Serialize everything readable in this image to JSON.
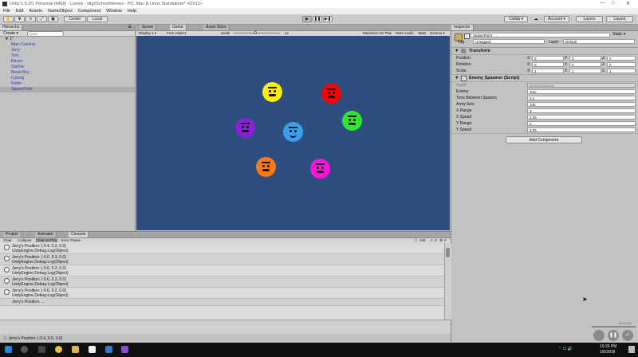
{
  "titlebar": {
    "title": "Unity 5.6.1f1 Personal (64bit) - Lonely - HighSchoolHeroes - PC, Mac & Linux Standalone* <DX11>"
  },
  "menu": [
    "File",
    "Edit",
    "Assets",
    "GameObject",
    "Component",
    "Window",
    "Help"
  ],
  "toolbar": {
    "center": "Center",
    "local": "Local",
    "collab": "Collab ▾",
    "account": "Account ▾",
    "layers": "Layers",
    "layout": "Layout"
  },
  "hierarchy": {
    "tab": "Hierarchy",
    "create": "Create ▾",
    "search_placeholder": "Q▾All",
    "scene": "1*",
    "items": [
      "Main Camera",
      "Jerry",
      "Tom",
      "Raven",
      "Starfire",
      "Beast Boy",
      "Cyborg",
      "Robin",
      "SpawnPoint"
    ]
  },
  "game": {
    "tabs": [
      "Scene",
      "Game",
      "Asset Store"
    ],
    "display": "Display 1 ▾",
    "aspect": "Free Aspect",
    "scale_label": "Scale",
    "scale_value": "1x",
    "options": [
      "Maximize On Play",
      "Mute Audio",
      "Stats",
      "Gizmos ▾"
    ],
    "faces": [
      {
        "name": "face-yellow",
        "color": "#ffee00"
      },
      {
        "name": "face-red",
        "color": "#ff0000"
      },
      {
        "name": "face-purple",
        "color": "#8a1fd8"
      },
      {
        "name": "face-blue",
        "color": "#3aa0ee"
      },
      {
        "name": "face-green",
        "color": "#2ee82e"
      },
      {
        "name": "face-orange",
        "color": "#ff7a10"
      },
      {
        "name": "face-magenta",
        "color": "#ff14d8"
      }
    ]
  },
  "console": {
    "tabs": [
      "Project",
      "Animator",
      "Console"
    ],
    "buttons": [
      "Clear",
      "Collapse",
      "Clear on Play",
      "Error Pause"
    ],
    "counts": {
      "log": "169",
      "warn": "0",
      "error": "0"
    },
    "entries": [
      {
        "line1": "Jerry's Position: (-0.4, 5.3, 0.0)",
        "line2": "UnityEngine.Debug:Log(Object)"
      },
      {
        "line1": "Jerry's Position: (-0.6, 5.3, 0.0)",
        "line2": "UnityEngine.Debug:Log(Object)"
      },
      {
        "line1": "Jerry's Position: (-0.6, 5.3, 0.0)",
        "line2": "UnityEngine.Debug:Log(Object)"
      },
      {
        "line1": "Jerry's Position: (-0.6, 5.3, 0.0)",
        "line2": "UnityEngine.Debug:Log(Object)"
      },
      {
        "line1": "Jerry's Position: (-0.6, 5.2, 0.0)",
        "line2": "UnityEngine.Debug:Log(Object)"
      }
    ],
    "partial": "Jerry's Position: ...",
    "status": "Jerry's Position: (-0.4, 5.5, 0.0)"
  },
  "inspector": {
    "tab": "Inspector",
    "object_name": "SpawnPoint",
    "static": "Static ▾",
    "tag_label": "Tag",
    "tag_value": "Untagged",
    "layer_label": "Layer",
    "layer_value": "Default",
    "transform": {
      "title": "Transform",
      "rows": [
        {
          "label": "Position",
          "x": "0",
          "y": "0",
          "z": "0"
        },
        {
          "label": "Rotation",
          "x": "0",
          "y": "0",
          "z": "0"
        },
        {
          "label": "Scale",
          "x": "1",
          "y": "1",
          "z": "1"
        }
      ]
    },
    "spawner": {
      "title": "Enemy Spawner (Script)",
      "rows": [
        {
          "label": "Script",
          "value": "EnemySpawner"
        },
        {
          "label": "Enemy",
          "value": "Tom"
        },
        {
          "label": "Time Between Spawns",
          "value": "0.1"
        },
        {
          "label": "Army Size",
          "value": "100"
        },
        {
          "label": "X Range",
          "value": "3"
        },
        {
          "label": "X Speed",
          "value": "0.05"
        },
        {
          "label": "Y Range",
          "value": "0"
        },
        {
          "label": "Y Speed",
          "value": "0.05"
        }
      ]
    },
    "add_component": "Add Component"
  },
  "taskbar": {
    "time": "10:26 PM",
    "date": "1/6/2018"
  },
  "video": {
    "timestamp": "00:00:09"
  }
}
